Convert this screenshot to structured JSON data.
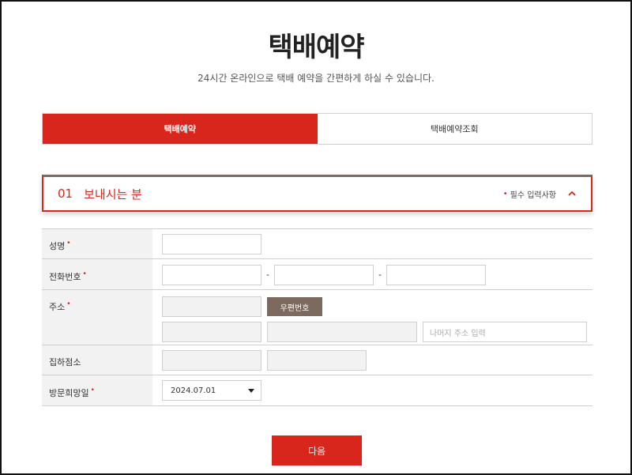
{
  "header": {
    "title": "택배예약",
    "subtitle": "24시간 온라인으로 택배 예약을 간편하게 하실 수 있습니다."
  },
  "tabs": [
    {
      "label": "택배예약",
      "active": true
    },
    {
      "label": "택배예약조회",
      "active": false
    }
  ],
  "section": {
    "number": "01",
    "title": "보내시는 분",
    "required_marker": "•",
    "required_note": "필수 입력사항",
    "collapse_icon": "chevron-up-icon"
  },
  "form": {
    "rows": [
      {
        "label": "성명",
        "required": true
      },
      {
        "label": "전화번호",
        "required": true,
        "separator": "-"
      },
      {
        "label": "주소",
        "required": true
      },
      {
        "label": "집하점소",
        "required": false
      },
      {
        "label": "방문희망일",
        "required": true
      }
    ],
    "zip_button_label": "우편번호",
    "address_detail_placeholder": "나머지 주소 입력",
    "visit_date_value": "2024.07.01"
  },
  "next_button_label": "다음",
  "colors": {
    "accent": "#d9261c",
    "brown": "#7c6a5f",
    "label_bg": "#f2f2f2",
    "border": "#cfcfcf"
  }
}
